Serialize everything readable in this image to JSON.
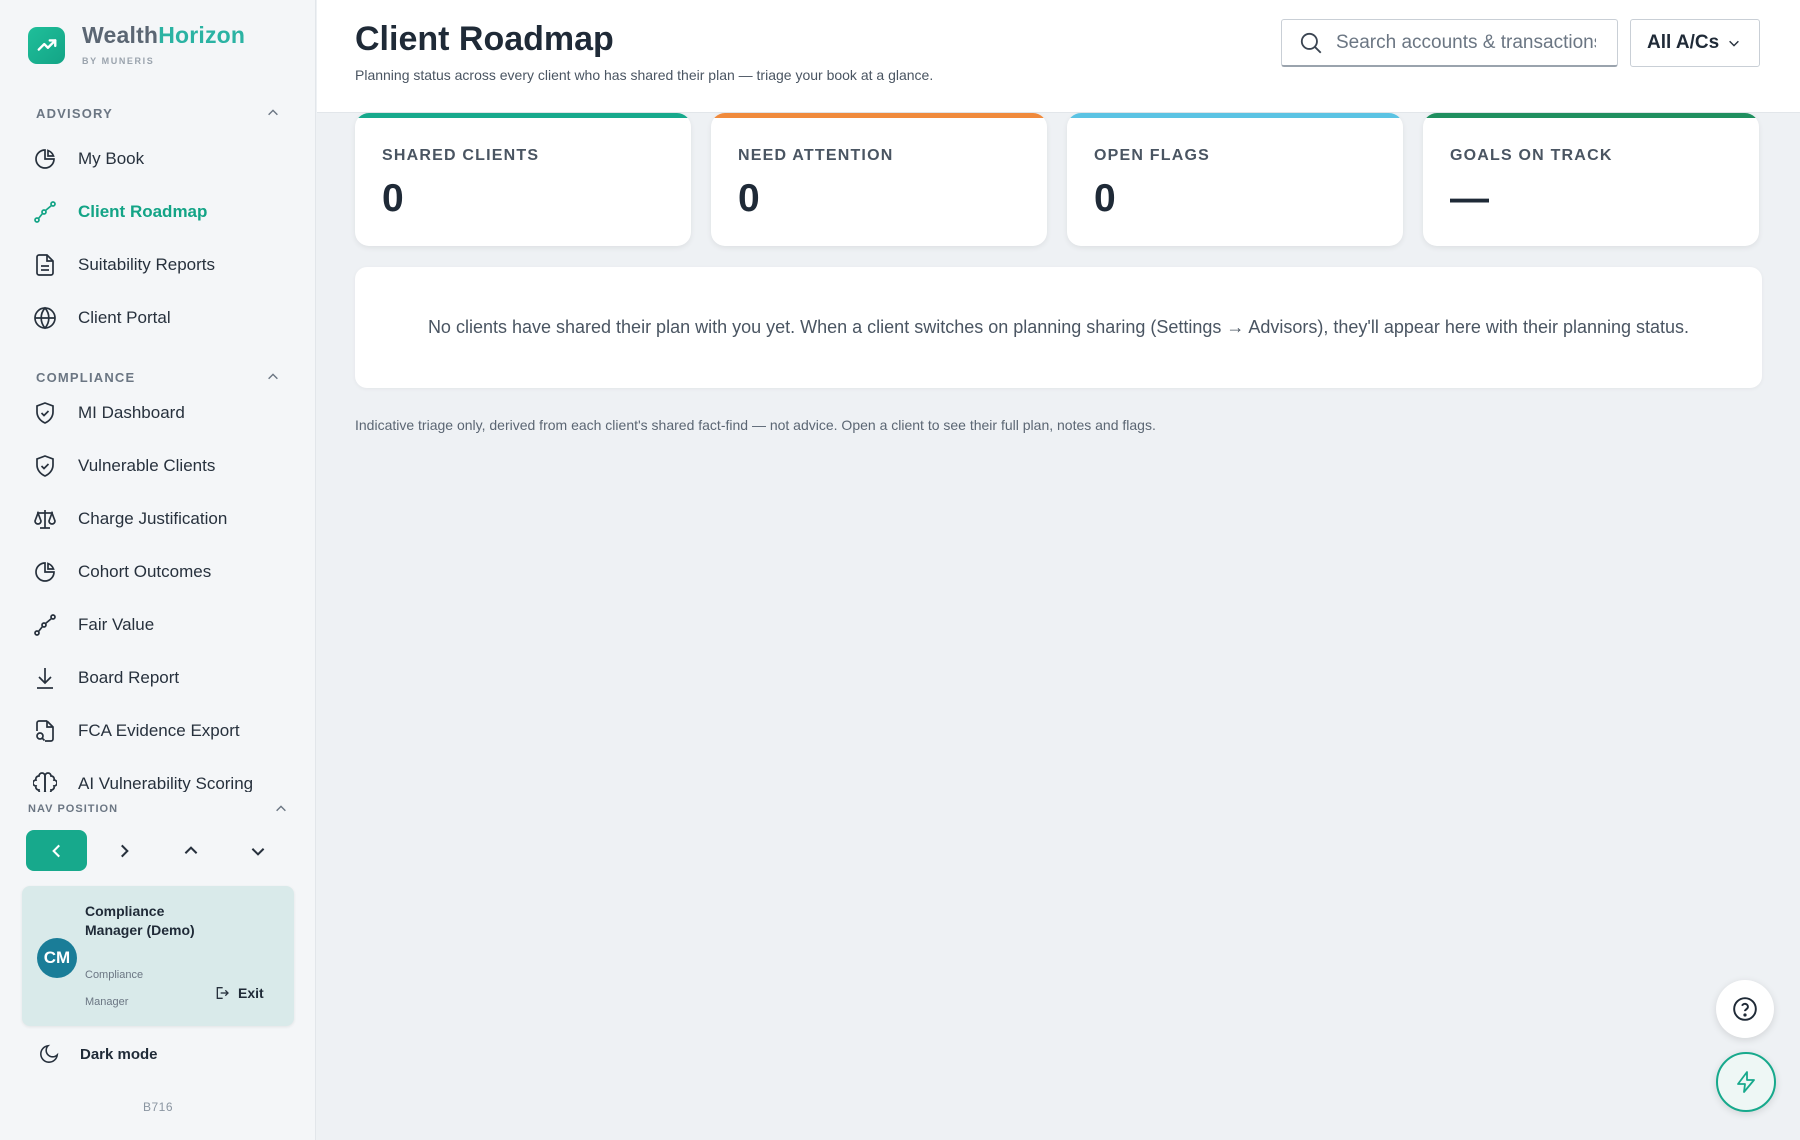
{
  "brand": {
    "name_part1": "Wealth",
    "name_part2": "Horizon",
    "sub": "BY MUNERIS"
  },
  "sidebar": {
    "advisory_title": "ADVISORY",
    "advisory_items": [
      {
        "label": "My Book",
        "icon": "pie-chart-icon"
      },
      {
        "label": "Client Roadmap",
        "icon": "route-icon",
        "active": true
      },
      {
        "label": "Suitability Reports",
        "icon": "document-icon"
      },
      {
        "label": "Client Portal",
        "icon": "globe-icon"
      }
    ],
    "compliance_title": "COMPLIANCE",
    "compliance_items": [
      {
        "label": "MI Dashboard",
        "icon": "shield-check-icon"
      },
      {
        "label": "Vulnerable Clients",
        "icon": "shield-check-icon"
      },
      {
        "label": "Charge Justification",
        "icon": "scales-icon"
      },
      {
        "label": "Cohort Outcomes",
        "icon": "pie-chart-icon"
      },
      {
        "label": "Fair Value",
        "icon": "route-icon"
      },
      {
        "label": "Board Report",
        "icon": "download-icon"
      },
      {
        "label": "FCA Evidence Export",
        "icon": "file-search-icon"
      },
      {
        "label": "AI Vulnerability Scoring",
        "icon": "brain-icon"
      }
    ],
    "nav_position_title": "NAV POSITION",
    "user": {
      "initials": "CM",
      "name": "Compliance Manager (Demo)",
      "role": "Compliance Manager",
      "exit_label": "Exit"
    },
    "dark_mode_label": "Dark mode",
    "build": "B716"
  },
  "header": {
    "title": "Client Roadmap",
    "subtitle": "Planning status across every client who has shared their plan — triage your book at a glance.",
    "search_placeholder": "Search accounts & transactions",
    "account_select": "All A/Cs"
  },
  "stats": [
    {
      "label": "SHARED CLIENTS",
      "value": "0",
      "color": "#17a98c"
    },
    {
      "label": "NEED ATTENTION",
      "value": "0",
      "color": "#f08a3c"
    },
    {
      "label": "OPEN FLAGS",
      "value": "0",
      "color": "#5bc3e3"
    },
    {
      "label": "GOALS ON TRACK",
      "value": "—",
      "color": "#1f8f5f"
    }
  ],
  "empty_message": "No clients have shared their plan with you yet. When a client switches on planning sharing (Settings → Advisors), they'll appear here with their planning status.",
  "footnote": "Indicative triage only, derived from each client's shared fact-find — not advice. Open a client to see their full plan, notes and flags."
}
